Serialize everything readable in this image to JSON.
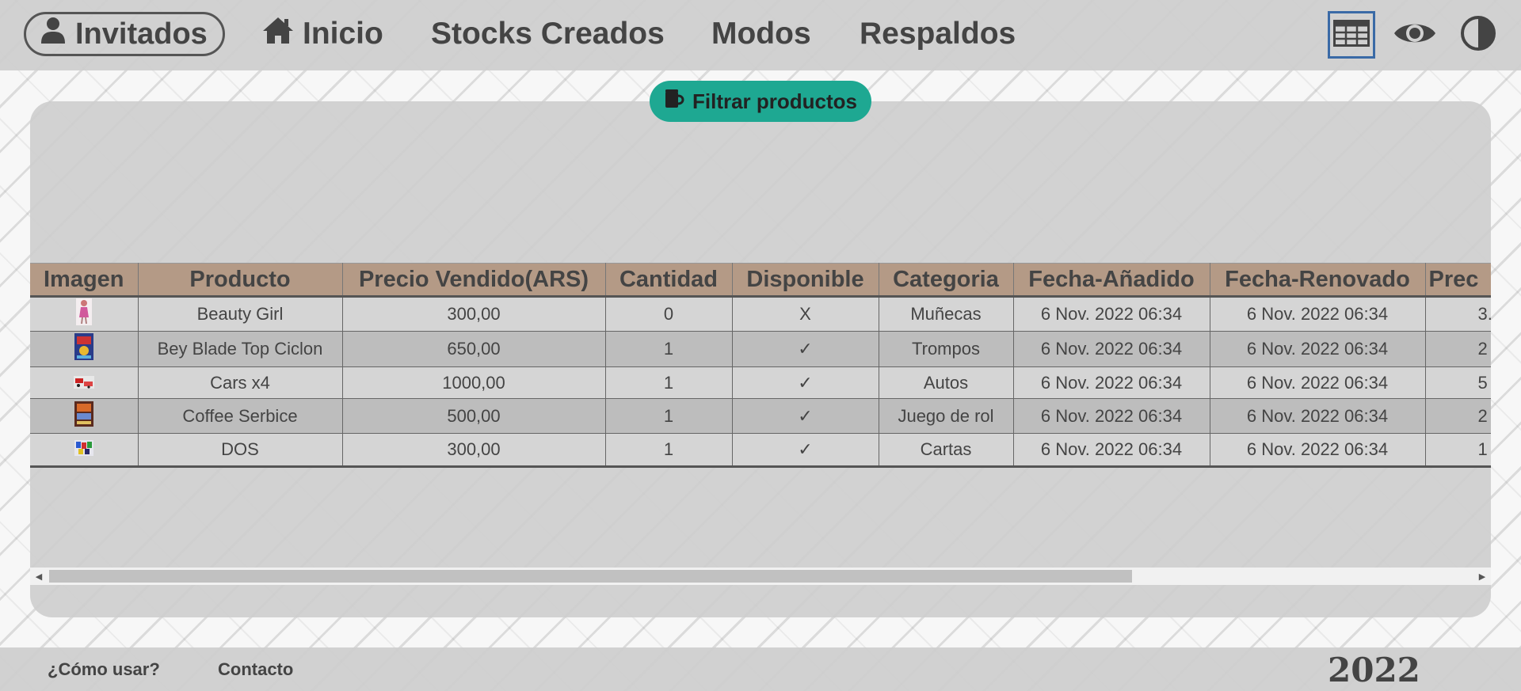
{
  "nav": {
    "user_label": "Invitados",
    "items": [
      {
        "label": "Inicio",
        "icon": "home-icon"
      },
      {
        "label": "Stocks Creados"
      },
      {
        "label": "Modos"
      },
      {
        "label": "Respaldos"
      }
    ],
    "icons": [
      "table-view-icon",
      "eye-icon",
      "contrast-icon"
    ],
    "accent": "#3a6aa6"
  },
  "filter": {
    "label": "Filtrar productos",
    "icon": "mug-icon",
    "color": "#1ea892"
  },
  "table": {
    "headers": [
      "Imagen",
      "Producto",
      "Precio Vendido(ARS)",
      "Cantidad",
      "Disponible",
      "Categoria",
      "Fecha-Añadido",
      "Fecha-Renovado",
      "Prec"
    ],
    "rows": [
      {
        "producto": "Beauty Girl",
        "precio": "300,00",
        "cantidad": "0",
        "disponible": "X",
        "categoria": "Muñecas",
        "added": "6 Nov. 2022 06:34",
        "renewed": "6 Nov. 2022 06:34",
        "prec": "3."
      },
      {
        "producto": "Bey Blade Top Ciclon",
        "precio": "650,00",
        "cantidad": "1",
        "disponible": "✓",
        "categoria": "Trompos",
        "added": "6 Nov. 2022 06:34",
        "renewed": "6 Nov. 2022 06:34",
        "prec": "2"
      },
      {
        "producto": "Cars x4",
        "precio": "1000,00",
        "cantidad": "1",
        "disponible": "✓",
        "categoria": "Autos",
        "added": "6 Nov. 2022 06:34",
        "renewed": "6 Nov. 2022 06:34",
        "prec": "5"
      },
      {
        "producto": "Coffee Serbice",
        "precio": "500,00",
        "cantidad": "1",
        "disponible": "✓",
        "categoria": "Juego de rol",
        "added": "6 Nov. 2022 06:34",
        "renewed": "6 Nov. 2022 06:34",
        "prec": "2"
      },
      {
        "producto": "DOS",
        "precio": "300,00",
        "cantidad": "1",
        "disponible": "✓",
        "categoria": "Cartas",
        "added": "6 Nov. 2022 06:34",
        "renewed": "6 Nov. 2022 06:34",
        "prec": "1"
      }
    ],
    "header_color": "#b49a86"
  },
  "footer": {
    "how_to": "¿Cómo usar?",
    "contact": "Contacto",
    "year": "2022"
  }
}
